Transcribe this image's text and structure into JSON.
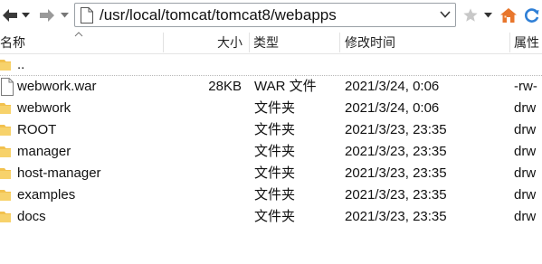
{
  "toolbar": {
    "address_path": "/usr/local/tomcat/tomcat8/webapps",
    "back_icon": "arrow-left-icon",
    "forward_icon": "arrow-right-icon",
    "bookmark_icon": "star-icon",
    "home_icon": "home-icon",
    "refresh_icon": "refresh-icon"
  },
  "columns": {
    "name": "名称",
    "size": "大小",
    "type": "类型",
    "modified": "修改时间",
    "attributes": "属性"
  },
  "files": [
    {
      "name": "..",
      "size": "",
      "type": "",
      "modified": "",
      "attributes": "",
      "icon": "folder-icon"
    },
    {
      "name": "webwork.war",
      "size": "28KB",
      "type": "WAR 文件",
      "modified": "2021/3/24, 0:06",
      "attributes": "-rw-",
      "icon": "file-icon"
    },
    {
      "name": "webwork",
      "size": "",
      "type": "文件夹",
      "modified": "2021/3/24, 0:06",
      "attributes": "drw",
      "icon": "folder-icon"
    },
    {
      "name": "ROOT",
      "size": "",
      "type": "文件夹",
      "modified": "2021/3/23, 23:35",
      "attributes": "drw",
      "icon": "folder-icon"
    },
    {
      "name": "manager",
      "size": "",
      "type": "文件夹",
      "modified": "2021/3/23, 23:35",
      "attributes": "drw",
      "icon": "folder-icon"
    },
    {
      "name": "host-manager",
      "size": "",
      "type": "文件夹",
      "modified": "2021/3/23, 23:35",
      "attributes": "drw",
      "icon": "folder-icon"
    },
    {
      "name": "examples",
      "size": "",
      "type": "文件夹",
      "modified": "2021/3/23, 23:35",
      "attributes": "drw",
      "icon": "folder-icon"
    },
    {
      "name": "docs",
      "size": "",
      "type": "文件夹",
      "modified": "2021/3/23, 23:35",
      "attributes": "drw",
      "icon": "folder-icon"
    }
  ],
  "colors": {
    "folder": "#f2c14e",
    "home": "#e8762c",
    "refresh": "#2f7fd6",
    "arrow": "#3a3a3a"
  }
}
